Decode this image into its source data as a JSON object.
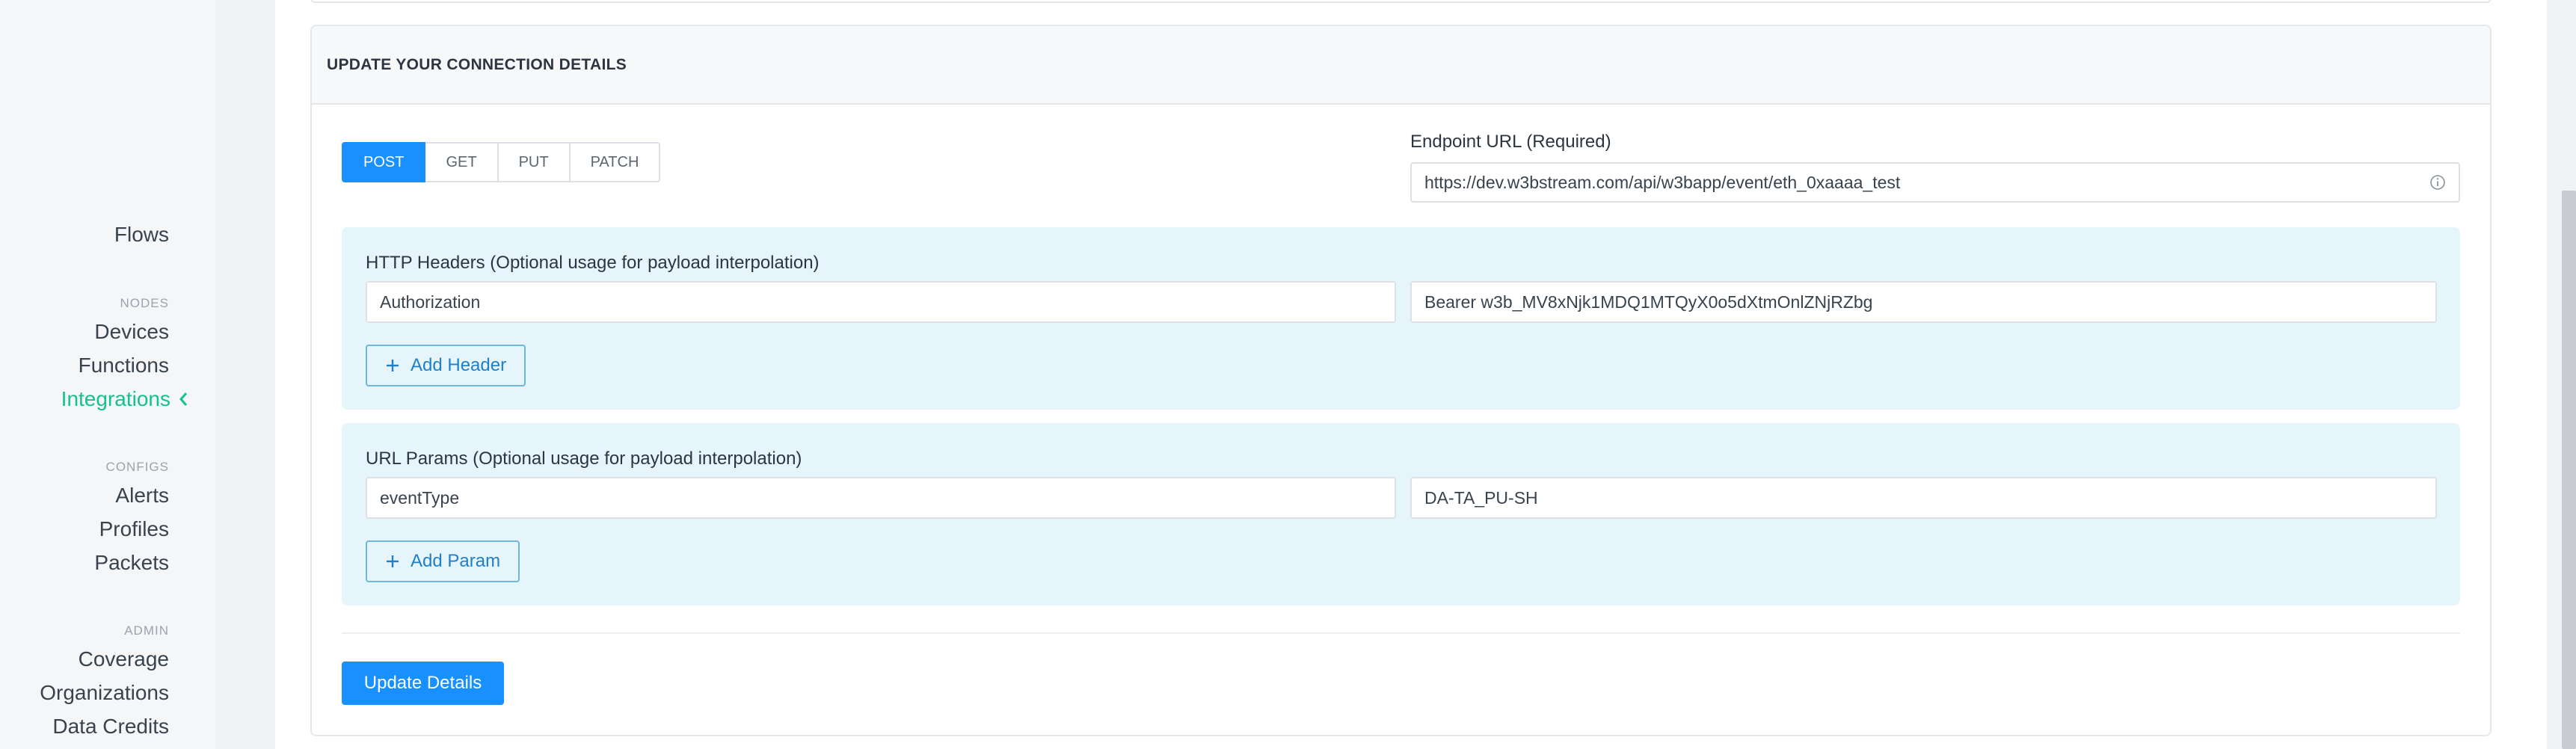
{
  "sidebar": {
    "flows": "Flows",
    "nodes_heading": "NODES",
    "devices": "Devices",
    "functions": "Functions",
    "integrations": "Integrations",
    "configs_heading": "CONFIGS",
    "alerts": "Alerts",
    "profiles": "Profiles",
    "packets": "Packets",
    "admin_heading": "ADMIN",
    "coverage": "Coverage",
    "organizations": "Organizations",
    "data_credits": "Data Credits",
    "active_color": "#13c28d"
  },
  "panel": {
    "title": "UPDATE YOUR CONNECTION DETAILS",
    "methods": [
      "POST",
      "GET",
      "PUT",
      "PATCH"
    ],
    "active_method": "POST",
    "endpoint_label": "Endpoint URL (Required)",
    "endpoint_value": "https://dev.w3bstream.com/api/w3bapp/event/eth_0xaaaa_test",
    "headers": {
      "title": "HTTP Headers (Optional usage for payload interpolation)",
      "key": "Authorization",
      "value": "Bearer w3b_MV8xNjk1MDQ1MTQyX0o5dXtmOnlZNjRZbg",
      "add_label": "Add Header"
    },
    "params": {
      "title": "URL Params (Optional usage for payload interpolation)",
      "key": "eventType",
      "value": "DA-TA_PU-SH",
      "add_label": "Add Param"
    },
    "update_label": "Update Details",
    "accent_color": "#1890ff"
  }
}
